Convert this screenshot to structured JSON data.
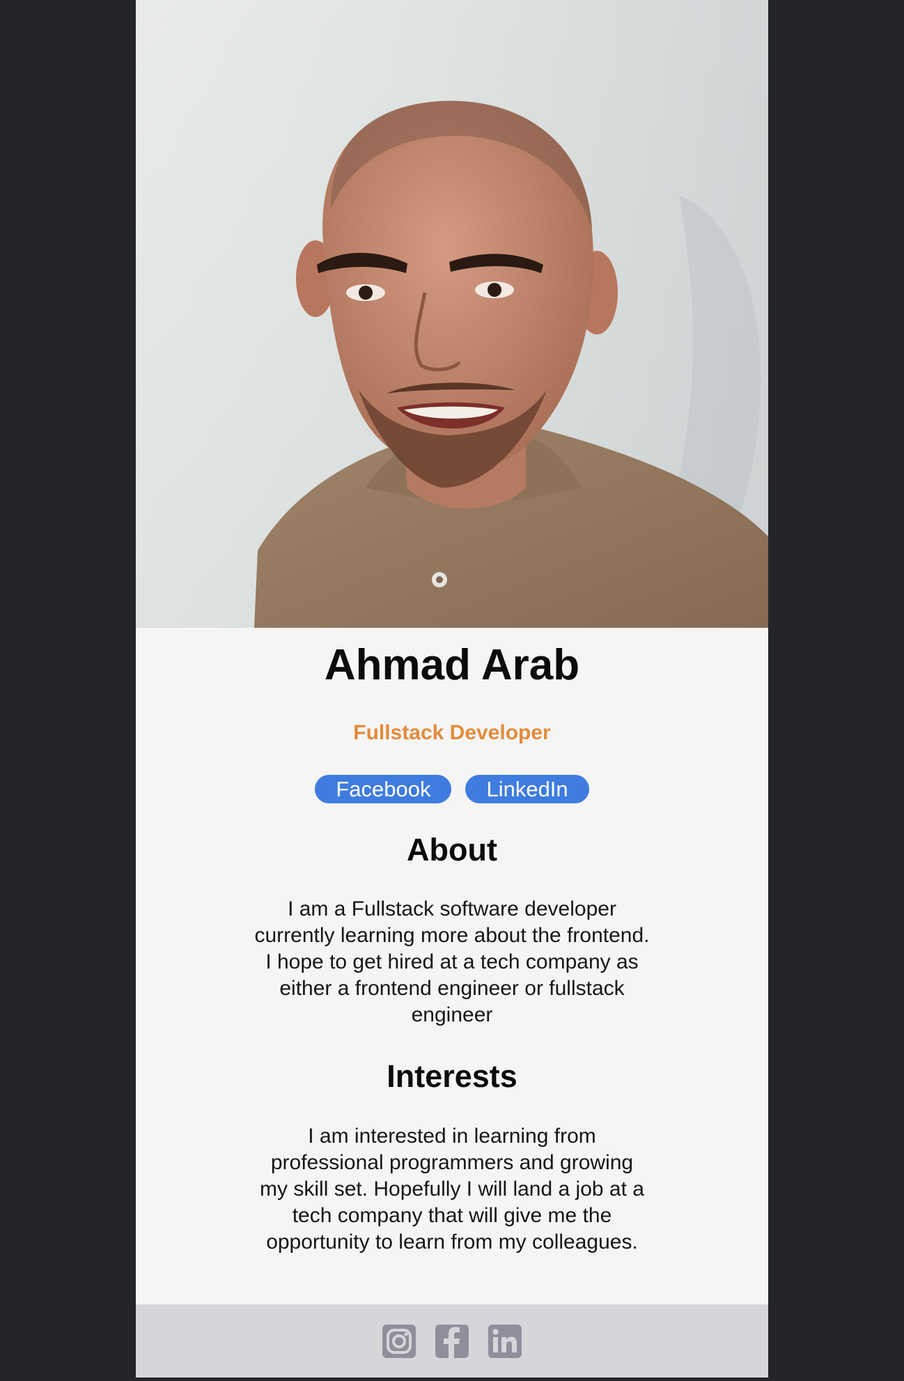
{
  "profile": {
    "name": "Ahmad Arab",
    "role": "Fullstack Developer"
  },
  "links": {
    "facebook_label": "Facebook",
    "linkedin_label": "LinkedIn"
  },
  "about": {
    "title": "About",
    "text": "I am a Fullstack software developer currently learning more about the frontend. I hope to get hired at a tech company as either a frontend engineer or fullstack engineer"
  },
  "interests": {
    "title": "Interests",
    "text": "I am interested in learning from professional programmers and growing my skill set. Hopefully I will land a job at a tech company that will give me the opportunity to learn from my colleagues."
  },
  "footer": {
    "icons": [
      "instagram-icon",
      "facebook-icon",
      "linkedin-icon"
    ]
  },
  "colors": {
    "page_background": "#23252b",
    "card_background": "#f5f5f5",
    "accent_orange": "#e38b3c",
    "button_blue": "#3f7cdf",
    "footer_background": "#d6d6da",
    "footer_icon": "#918e9b"
  }
}
